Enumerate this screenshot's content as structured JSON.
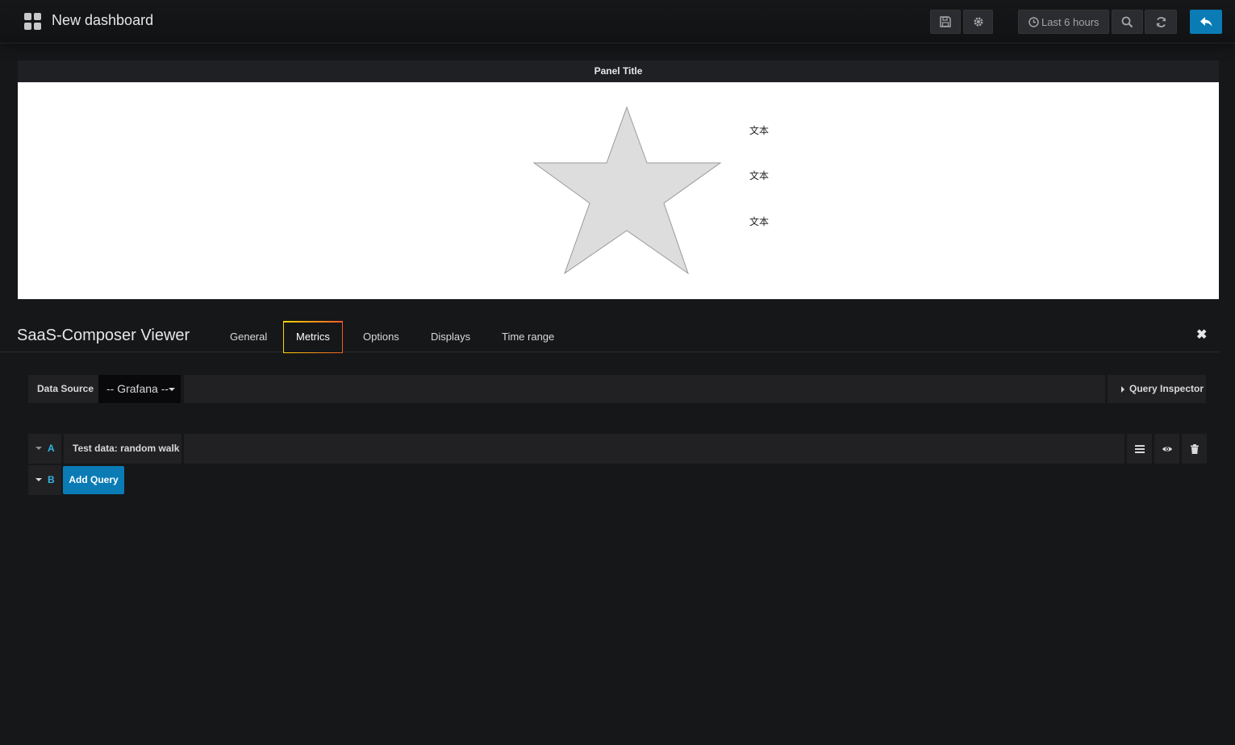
{
  "navbar": {
    "title": "New dashboard",
    "time_range_label": "Last 6 hours",
    "icons": [
      "dashboard-grid-icon",
      "save-icon",
      "gear-icon",
      "clock-icon",
      "zoom-out-icon",
      "refresh-icon",
      "back-arrow-icon"
    ]
  },
  "panel": {
    "title": "Panel Title",
    "shape": "star",
    "shape_fill": "#dddddd",
    "texts": [
      "文本",
      "文本",
      "文本"
    ]
  },
  "editor": {
    "title": "SaaS-Composer Viewer",
    "tabs": [
      {
        "label": "General",
        "active": false
      },
      {
        "label": "Metrics",
        "active": true
      },
      {
        "label": "Options",
        "active": false
      },
      {
        "label": "Displays",
        "active": false
      },
      {
        "label": "Time range",
        "active": false
      }
    ],
    "close_icon": "close-icon"
  },
  "metrics": {
    "data_source_label": "Data Source",
    "data_source_value": "-- Grafana --",
    "query_inspector_label": "Query Inspector",
    "queries": [
      {
        "letter": "A",
        "name": "Test data: random walk"
      },
      {
        "letter": "B"
      }
    ],
    "add_query_label": "Add Query",
    "row_actions": [
      "menu-icon",
      "eye-icon",
      "trash-icon"
    ]
  },
  "colors": {
    "accent_blue": "#0a7bb5",
    "query_letter": "#33b5e5",
    "active_tab_border": "#f08b1b"
  }
}
